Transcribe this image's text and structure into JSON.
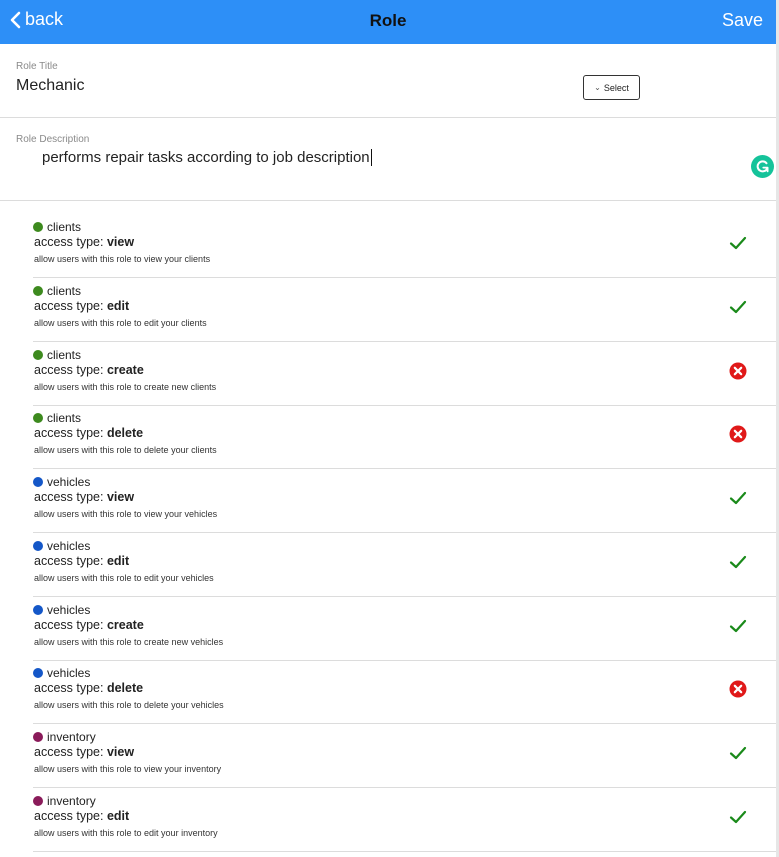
{
  "header": {
    "back_label": "back",
    "title": "Role",
    "save_label": "Save",
    "background": "#2d8ff7"
  },
  "role_title": {
    "label": "Role Title",
    "value": "Mechanic",
    "select_label": "Select"
  },
  "role_description": {
    "label": "Role Description",
    "value": "performs repair tasks according to job description"
  },
  "access_type_label": "access type: ",
  "colors": {
    "clients": "#3d8a1e",
    "vehicles": "#1457c8",
    "inventory": "#8a1b5a",
    "allowed": "#1a8a1a",
    "denied": "#e01919"
  },
  "permissions": [
    {
      "resource": "clients",
      "access": "view",
      "description": "allow users with this role to view your clients",
      "allowed": true
    },
    {
      "resource": "clients",
      "access": "edit",
      "description": "allow users with this role to edit your clients",
      "allowed": true
    },
    {
      "resource": "clients",
      "access": "create",
      "description": "allow users with this role to create new clients",
      "allowed": false
    },
    {
      "resource": "clients",
      "access": "delete",
      "description": "allow users with this role to delete your clients",
      "allowed": false
    },
    {
      "resource": "vehicles",
      "access": "view",
      "description": "allow users with this role to view your vehicles",
      "allowed": true
    },
    {
      "resource": "vehicles",
      "access": "edit",
      "description": "allow users with this role to edit your vehicles",
      "allowed": true
    },
    {
      "resource": "vehicles",
      "access": "create",
      "description": "allow users with this role to create new vehicles",
      "allowed": true
    },
    {
      "resource": "vehicles",
      "access": "delete",
      "description": "allow users with this role to delete your vehicles",
      "allowed": false
    },
    {
      "resource": "inventory",
      "access": "view",
      "description": "allow users with this role to view your inventory",
      "allowed": true
    },
    {
      "resource": "inventory",
      "access": "edit",
      "description": "allow users with this role to edit your inventory",
      "allowed": true
    }
  ]
}
